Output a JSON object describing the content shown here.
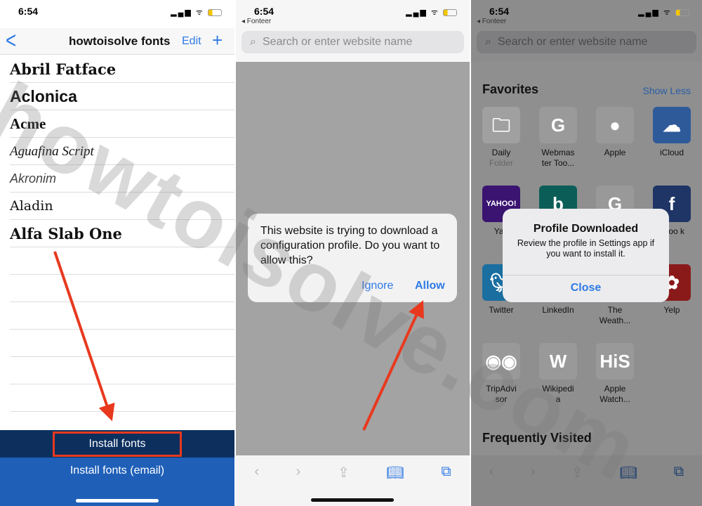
{
  "time": "6:54",
  "panel1": {
    "title": "howtoisolve fonts",
    "back": "<",
    "edit": "Edit",
    "add": "+",
    "fonts": [
      "Abril Fatface",
      "Aclonica",
      "Acme",
      "Aguafina Script",
      "Akronim",
      "Aladin",
      "Alfa Slab One"
    ],
    "install": "Install fonts",
    "install_email": "Install fonts (email)"
  },
  "panel2": {
    "back_app": "◂ Fonteer",
    "search_placeholder": "Search or enter website name",
    "dialog": {
      "message": "This website is trying to download a configuration profile. Do you want to allow this?",
      "ignore": "Ignore",
      "allow": "Allow"
    }
  },
  "panel3": {
    "back_app": "◂ Fonteer",
    "search_placeholder": "Search or enter website name",
    "favorites": "Favorites",
    "show_less": "Show Less",
    "items": [
      {
        "label": "Daily",
        "sub": "Folder"
      },
      {
        "label": "Webmas ter Too..."
      },
      {
        "label": "Apple"
      },
      {
        "label": "iCloud"
      },
      {
        "label": "Yah"
      },
      {
        "label": ""
      },
      {
        "label": ""
      },
      {
        "label": "eboo k"
      },
      {
        "label": "Twitter"
      },
      {
        "label": "LinkedIn"
      },
      {
        "label": "The Weath..."
      },
      {
        "label": "Yelp"
      },
      {
        "label": "TripAdvi sor"
      },
      {
        "label": "Wikipedi a"
      },
      {
        "label": "Apple Watch..."
      }
    ],
    "frequently": "Frequently Visited",
    "dialog": {
      "title": "Profile Downloaded",
      "message": "Review the profile in Settings app if you want to install it.",
      "close": "Close"
    }
  },
  "watermark": "howtoisolve.com",
  "colors": {
    "accent": "#2f7ae5",
    "arrow": "#e8391f",
    "navy": "#0c2f5e",
    "blue": "#1f5fb8"
  }
}
